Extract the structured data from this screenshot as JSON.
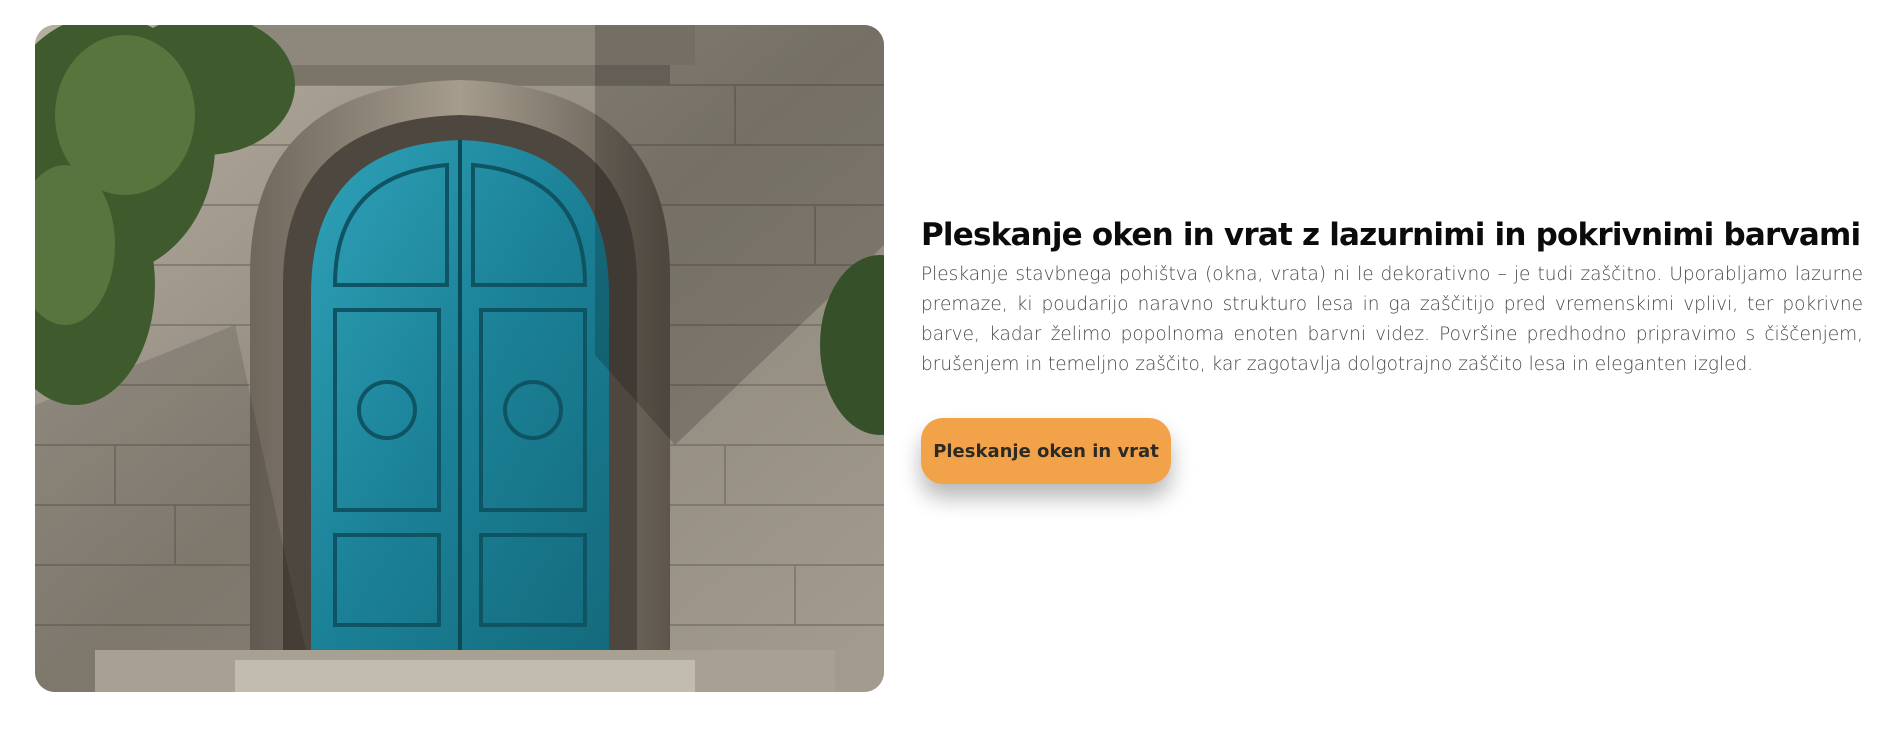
{
  "image": {
    "alt_icon": "door-photo",
    "door_color": "#1f8fa5",
    "stone_color": "#9c958a"
  },
  "section": {
    "title": "Pleskanje oken in vrat z lazurnimi in pokrivnimi barvami",
    "body": "Pleskanje stavbnega pohištva (okna, vrata) ni le dekorativno – je tudi zaščitno. Uporabljamo lazurne premaze, ki poudarijo naravno strukturo lesa in ga zaščitijo pred vremenskimi vplivi, ter pokrivne barve, kadar želimo popolnoma enoten barvni videz. Površine predhodno pripravimo s čiščenjem, brušenjem in temeljno zaščito, kar zagotavlja dolgotrajno zaščito lesa in eleganten izgled.",
    "button_label": "Pleskanje oken in vrat",
    "accent": "#f2a34a"
  }
}
